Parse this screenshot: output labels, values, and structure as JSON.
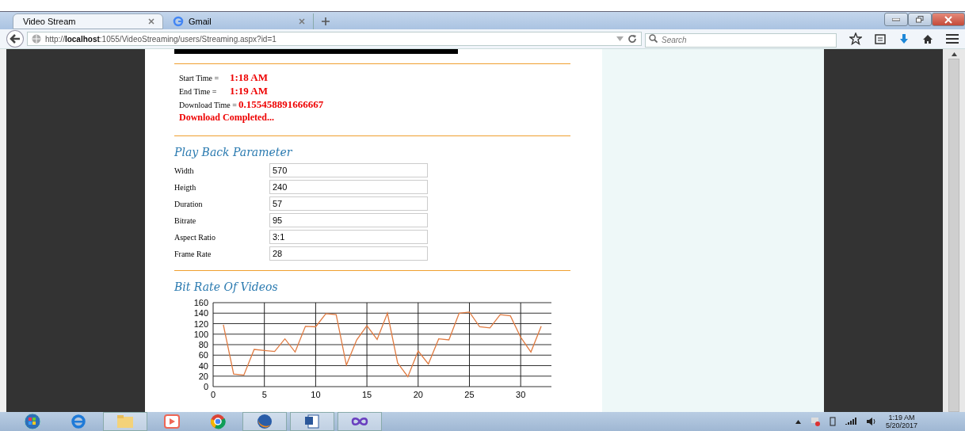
{
  "tabs": [
    {
      "label": "Video Stream",
      "selected": true,
      "kind": "page"
    },
    {
      "label": "Gmail",
      "selected": false,
      "kind": "google"
    }
  ],
  "address": {
    "prefix": "http://",
    "host": "localhost",
    "rest": ":1055/VideoStreaming/users/Streaming.aspx?id=1"
  },
  "search": {
    "placeholder": "Search"
  },
  "times": [
    {
      "label": "Start Time =",
      "value": "1:18 AM"
    },
    {
      "label": "End Time =",
      "value": "1:19 AM"
    },
    {
      "label": "Download Time =",
      "value": "0.155458891666667"
    }
  ],
  "status": "Download Completed...",
  "playback": {
    "title": "Play Back Parameter",
    "fields": [
      {
        "label": "Width",
        "value": "570"
      },
      {
        "label": "Heigth",
        "value": "240"
      },
      {
        "label": "Duration",
        "value": "57"
      },
      {
        "label": "Bitrate",
        "value": "95"
      },
      {
        "label": "Aspect Ratio",
        "value": "3:1"
      },
      {
        "label": "Frame Rate",
        "value": "28"
      }
    ]
  },
  "bitrate": {
    "title": "Bit Rate Of Videos",
    "chart_data": {
      "type": "line",
      "x": [
        1,
        2,
        3,
        4,
        5,
        6,
        7,
        8,
        9,
        10,
        11,
        12,
        13,
        14,
        15,
        16,
        17,
        18,
        19,
        20,
        21,
        22,
        23,
        24,
        25,
        26,
        27,
        28,
        29,
        30,
        31,
        32
      ],
      "grid": true,
      "series": [
        {
          "color": "#e07a40",
          "values": [
            118,
            24,
            22,
            71,
            69,
            67,
            91,
            66,
            115,
            114,
            139,
            137,
            41,
            89,
            116,
            90,
            140,
            45,
            19,
            68,
            43,
            91,
            89,
            140,
            142,
            114,
            112,
            137,
            135,
            94,
            66,
            115
          ]
        }
      ],
      "xlim": [
        0,
        33
      ],
      "ylim": [
        0,
        160
      ],
      "xticks": [
        0,
        5,
        10,
        15,
        20,
        25,
        30
      ],
      "yticks": [
        0,
        20,
        40,
        60,
        80,
        100,
        120,
        140,
        160
      ]
    }
  },
  "clock": {
    "time": "1:19 AM",
    "date": "5/20/2017"
  }
}
